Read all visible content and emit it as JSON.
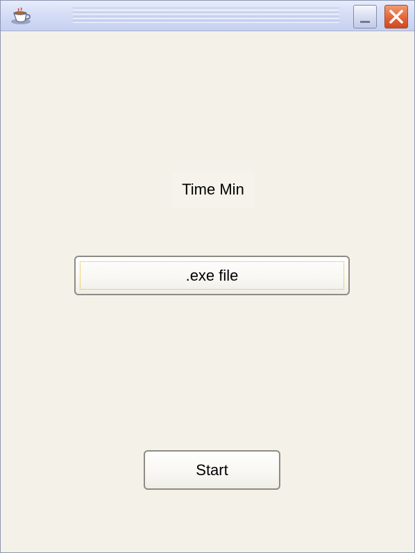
{
  "window": {
    "app_icon": "coffee-cup-icon",
    "minimize_icon": "minimize-icon",
    "close_icon": "close-icon"
  },
  "main": {
    "time_label": "Time Min",
    "exe_button_label": ".exe file",
    "start_button_label": "Start"
  },
  "colors": {
    "window_background": "#f4f1e9",
    "close_button": "#e2643a",
    "focus_outline": "#e3b300"
  }
}
